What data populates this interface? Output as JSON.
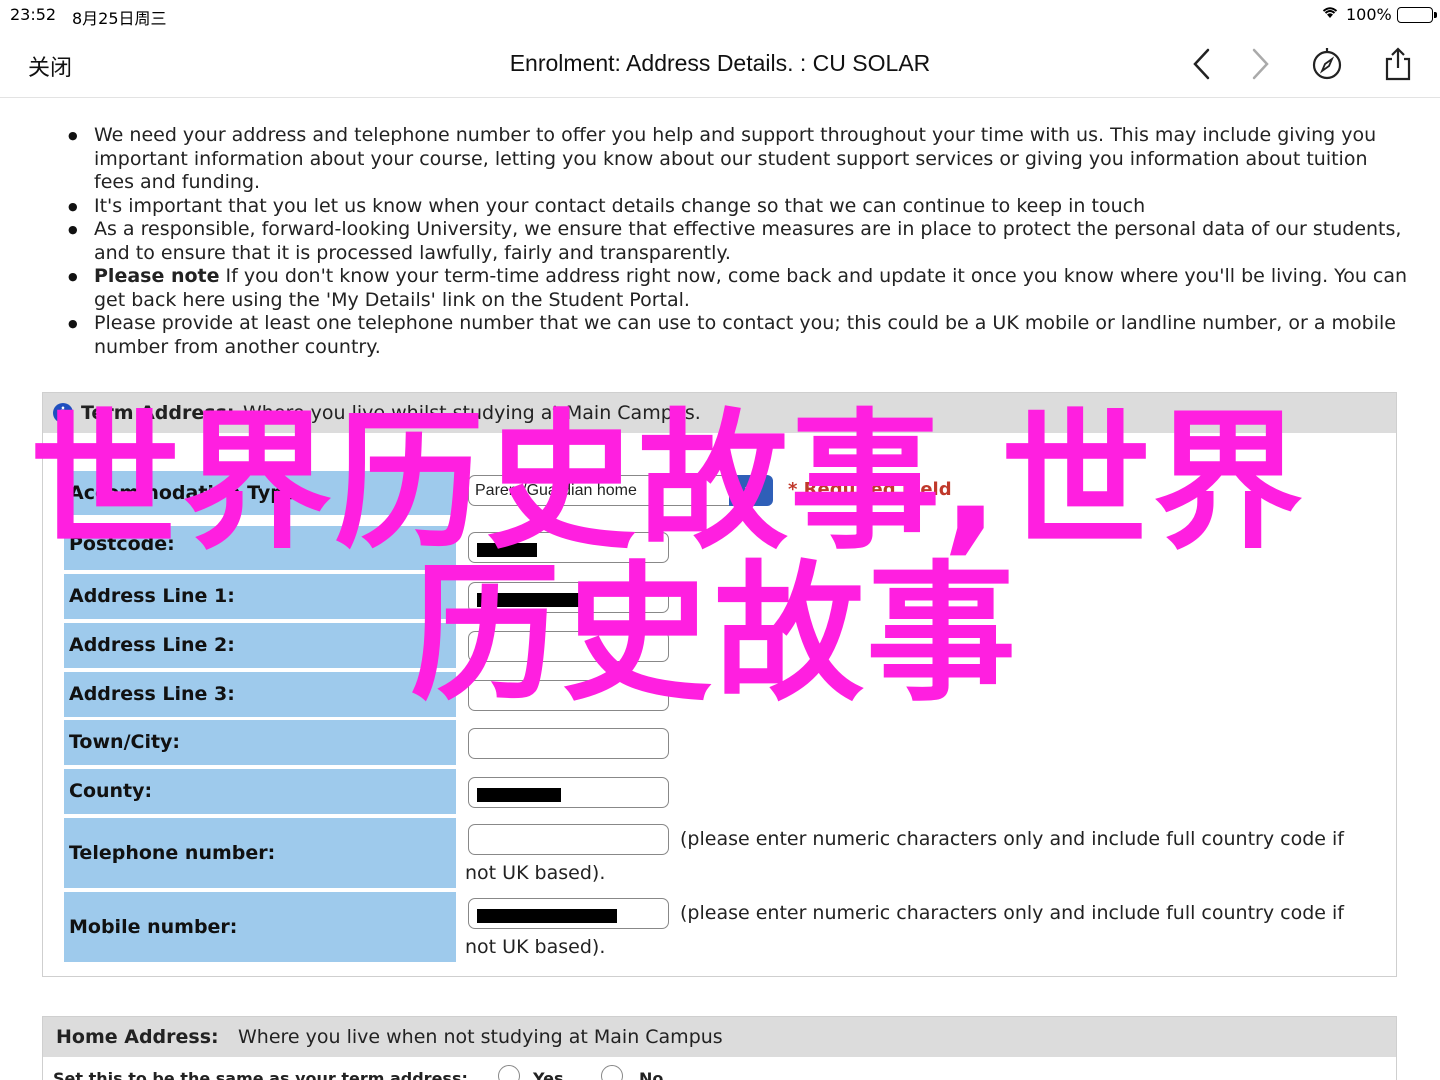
{
  "status_bar": {
    "time": "23:52",
    "date": "8月25日周三",
    "battery": "100%"
  },
  "nav": {
    "close_label": "关闭",
    "title": "Enrolment: Address Details. : CU SOLAR"
  },
  "intro": {
    "bullets": [
      {
        "bold": "",
        "text": "We need your address and telephone number to offer you help and support throughout your time with us. This may include giving you important information about your course, letting you know about our student support services or giving you information about tuition fees and funding."
      },
      {
        "bold": "",
        "text": "It's important that you let us know when your contact details change so that we can continue to keep in touch"
      },
      {
        "bold": "",
        "text": "As a responsible, forward-looking University, we ensure that effective measures are in place to protect the personal data of our students, and to ensure that it is processed lawfully, fairly and transparently."
      },
      {
        "bold": "Please note",
        "text": " If you don't know your term-time address right now, come back and update it once you know where you'll be living. You can get back here using the 'My Details' link on the Student Portal."
      },
      {
        "bold": "",
        "text": "Please provide at least one telephone number that we can use to contact you; this could be a UK mobile or landline number, or a mobile number from another country."
      }
    ]
  },
  "term_address": {
    "heading": "Term Address:",
    "description": "Where you live whilst studying at Main Campus.",
    "accommodation_label": "Accommodation Type:",
    "accommodation_value": "Parent/Guardian home",
    "required_note": "* Required Field",
    "postcode_label": "Postcode:",
    "address1_label": "Address Line 1:",
    "address2_label": "Address Line 2:",
    "address3_label": "Address Line 3:",
    "town_label": "Town/City:",
    "county_label": "County:",
    "telephone_label": "Telephone number:",
    "mobile_label": "Mobile number:",
    "phone_hint_line1": "(please enter numeric characters only and include full country code if",
    "phone_hint_line2": "not UK based)."
  },
  "home_address": {
    "heading": "Home Address:",
    "description": "Where you live when not studying at Main Campus",
    "same_question": "Set this to be the same as your term address:",
    "yes_label": "Yes",
    "no_label": "No"
  },
  "watermark": {
    "line1": "世界历史故事,世界",
    "line2": "历史故事"
  },
  "colors": {
    "label_bg": "#9ecaec",
    "panel_head_bg": "#dcdcdc",
    "watermark": "#ff1fe0",
    "select_button": "#2f5fb8"
  }
}
